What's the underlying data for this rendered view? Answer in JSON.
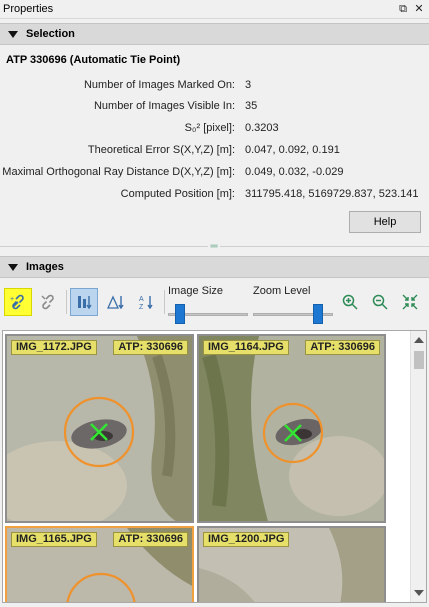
{
  "window": {
    "title": "Properties"
  },
  "selection": {
    "header": "Selection",
    "title": "ATP 330696 (Automatic Tie Point)",
    "rows": [
      {
        "label": "Number of Images Marked On:",
        "value": "3"
      },
      {
        "label": "Number of Images Visible In:",
        "value": "35"
      },
      {
        "label": "S₀² [pixel]:",
        "value": "0.3203"
      },
      {
        "label": "Theoretical Error S(X,Y,Z) [m]:",
        "value": "0.047, 0.092, 0.191"
      },
      {
        "label": "Maximal Orthogonal Ray Distance D(X,Y,Z) [m]:",
        "value": "0.049, 0.032, -0.029"
      },
      {
        "label": "Computed Position [m]:",
        "value": "311795.418, 5169729.837, 523.141"
      }
    ],
    "help_label": "Help"
  },
  "images": {
    "header": "Images",
    "image_size_label": "Image Size",
    "zoom_level_label": "Zoom Level",
    "image_size_level": 0.1,
    "zoom_level_level": 0.85,
    "tiles": [
      {
        "name": "IMG_1172.JPG",
        "atp": "ATP: 330696"
      },
      {
        "name": "IMG_1164.JPG",
        "atp": "ATP: 330696"
      },
      {
        "name": "IMG_1165.JPG",
        "atp": "ATP: 330696"
      },
      {
        "name": "IMG_1200.JPG",
        "atp": ""
      }
    ]
  },
  "icons": {
    "link": "link-icon",
    "unlink": "unlink-icon",
    "sort_images": "sort-images-icon",
    "sort_error": "sort-error-icon",
    "sort_name": "sort-name-icon",
    "zoom_in": "zoom-in-icon",
    "zoom_out": "zoom-out-icon",
    "fit": "fit-to-window-icon"
  },
  "colors": {
    "marker_circle": "#f0922c",
    "marker_cross": "#33e633",
    "tag_bg": "#e6e06a",
    "active_tool": "#ffff33",
    "slider": "#1e78d2"
  }
}
